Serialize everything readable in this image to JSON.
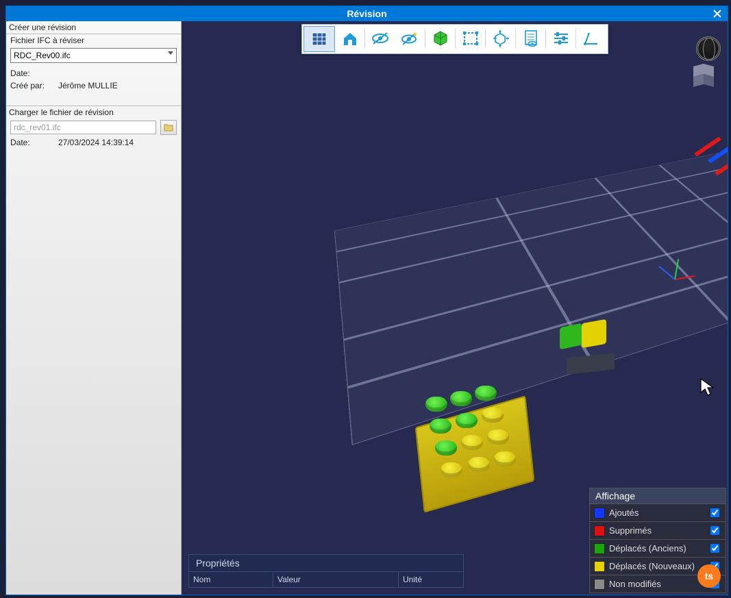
{
  "window": {
    "title": "Révision"
  },
  "side": {
    "create_header": "Créer une révision",
    "ifc_label": "Fichier IFC à réviser",
    "ifc_value": "RDC_Rev00.ifc",
    "date_label": "Date:",
    "ifc_date": "",
    "created_by_label": "Créé par:",
    "created_by": "Jérôme MULLIE",
    "load_header": "Charger le fichier de révision",
    "rev_file": "rdc_rev01.ifc",
    "rev_date": "27/03/2024 14:39:14"
  },
  "props": {
    "title": "Propriétés",
    "cols": [
      "Nom",
      "Valeur",
      "Unité"
    ]
  },
  "legend": {
    "title": "Affichage",
    "items": [
      {
        "label": "Ajoutés",
        "color": "#1437ff",
        "checked": true
      },
      {
        "label": "Supprimés",
        "color": "#e01010",
        "checked": true
      },
      {
        "label": "Déplacés (Anciens)",
        "color": "#1aa50c",
        "checked": true
      },
      {
        "label": "Déplacés (Nouveaux)",
        "color": "#e8d100",
        "checked": true
      },
      {
        "label": "Non modifiés",
        "color": "#8a8a8a",
        "checked": true
      }
    ]
  },
  "badge": "ts"
}
